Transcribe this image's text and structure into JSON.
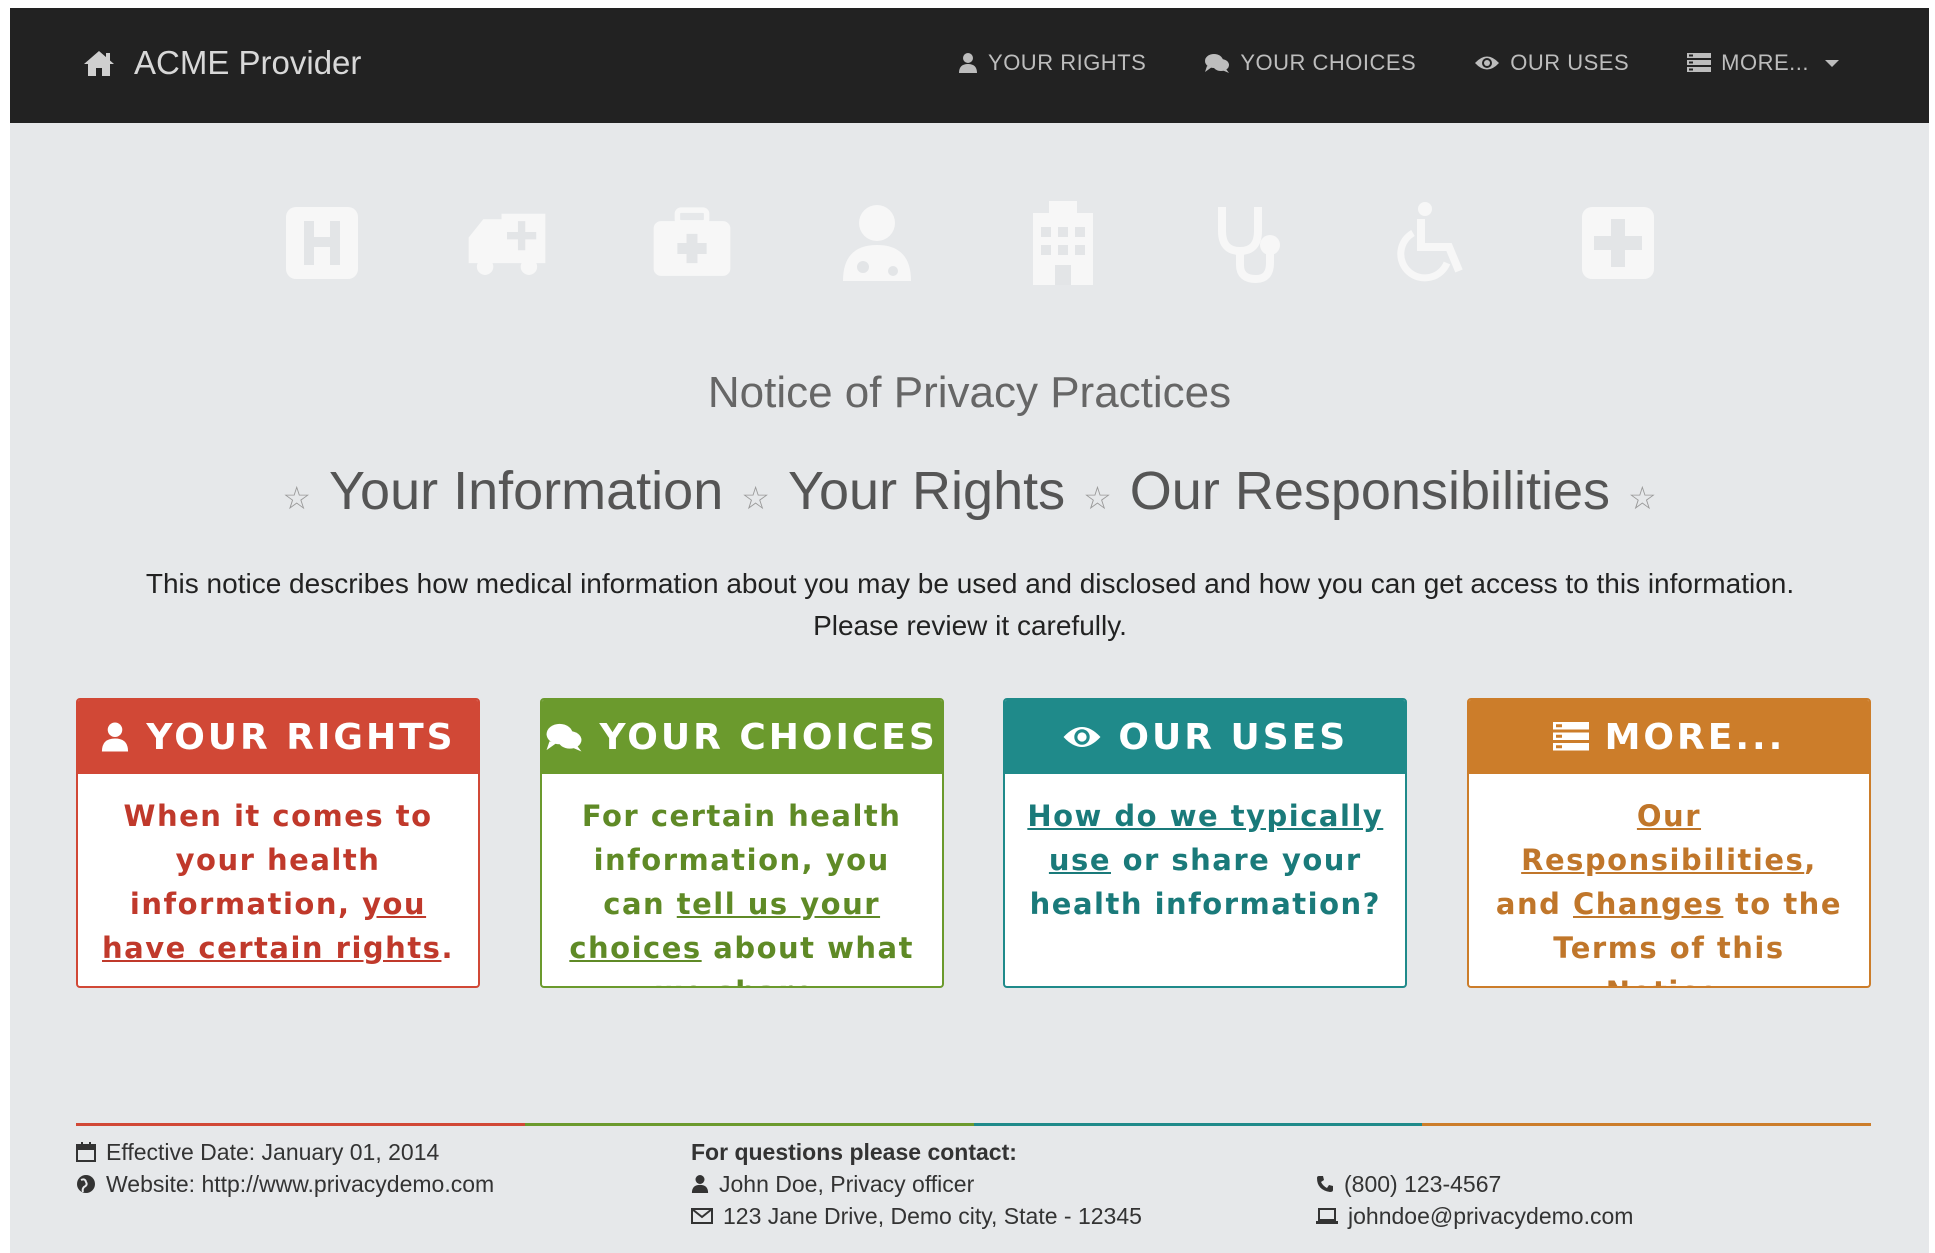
{
  "navbar": {
    "brand": "ACME Provider",
    "brand_icon": "home-icon",
    "links": [
      {
        "label": "YOUR RIGHTS",
        "icon": "user-icon"
      },
      {
        "label": "YOUR CHOICES",
        "icon": "comments-icon"
      },
      {
        "label": "OUR USES",
        "icon": "eye-icon"
      },
      {
        "label": "MORE...",
        "icon": "list-icon"
      }
    ]
  },
  "icon_strip": [
    "hospital-h-icon",
    "ambulance-icon",
    "medkit-icon",
    "doctor-icon",
    "hospital-building-icon",
    "stethoscope-icon",
    "wheelchair-icon",
    "plus-square-icon"
  ],
  "main": {
    "title": "Notice of Privacy Practices",
    "subtitles": [
      "Your Information",
      "Your Rights",
      "Our Responsibilities"
    ],
    "description": "This notice describes how medical information about you may be used and disclosed and how you can get access to this information.",
    "description_emphasis": "Please review it carefully."
  },
  "cards": [
    {
      "title": "YOUR RIGHTS",
      "icon": "user-icon",
      "color": "#d14836",
      "text_1": "When it comes to your health information, ",
      "link_1": "you have certain rights",
      "text_2": "."
    },
    {
      "title": "YOUR CHOICES",
      "icon": "comments-icon",
      "color": "#6b9a2d",
      "text_1": "For certain health information, you can ",
      "link_1": "tell us your choices",
      "text_2": " about what we share."
    },
    {
      "title": "OUR USES",
      "icon": "eye-icon",
      "color": "#1f8a8a",
      "link_1": "How do we typically",
      "text_1": " ",
      "link_2": "use",
      "text_2": " or share your health information?"
    },
    {
      "title": "MORE...",
      "icon": "list-icon",
      "color": "#cc7d2a",
      "link_1": "Our Responsibilities",
      "text_1": ", and ",
      "link_2": "Changes",
      "text_2": " to the Terms of this Notice."
    }
  ],
  "footer": {
    "effective_date": "Effective Date: January 01, 2014",
    "website": "Website: http://www.privacydemo.com",
    "contact_heading": "For questions please contact:",
    "contact_name": "John Doe, Privacy officer",
    "address": "123 Jane Drive, Demo city, State - 12345",
    "phone": "(800) 123-4567",
    "email": "johndoe@privacydemo.com"
  }
}
